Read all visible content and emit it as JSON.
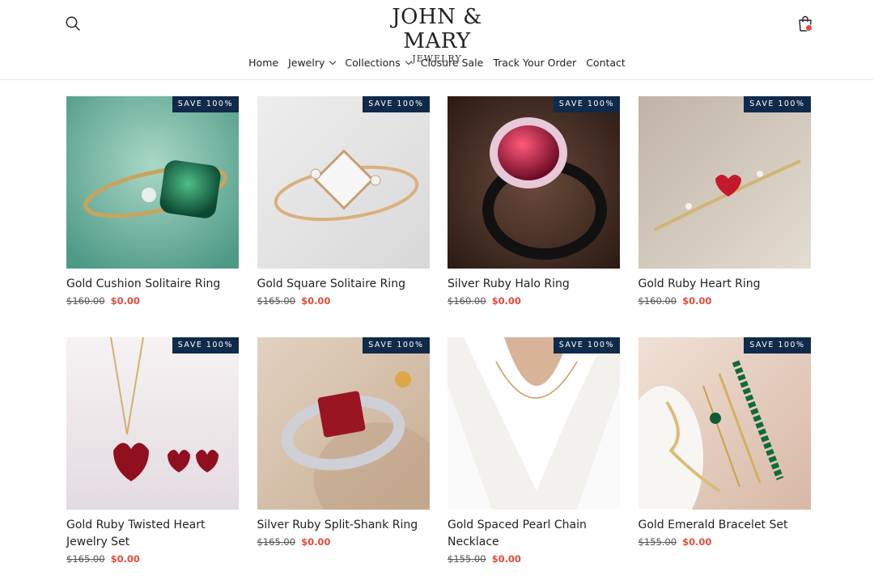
{
  "brand": {
    "name": "JOHN & MARY",
    "sub": "JEWELRY"
  },
  "nav": {
    "items": [
      {
        "label": "Home",
        "dropdown": false
      },
      {
        "label": "Jewelry",
        "dropdown": true
      },
      {
        "label": "Collections",
        "dropdown": true
      },
      {
        "label": "Closure Sale",
        "dropdown": false
      },
      {
        "label": "Track Your Order",
        "dropdown": false
      },
      {
        "label": "Contact",
        "dropdown": false
      }
    ]
  },
  "icons": {
    "search": "search-icon",
    "cart": "shopping-bag-icon"
  },
  "colors": {
    "badge": "#0f2a4a",
    "sale_price": "#e24b3b",
    "cart_dot": "#e8473a"
  },
  "products": [
    {
      "badge": "SAVE 100%",
      "title": "Gold Cushion Solitaire Ring",
      "old_price": "$160.00",
      "price": "$0.00"
    },
    {
      "badge": "SAVE 100%",
      "title": "Gold Square Solitaire Ring",
      "old_price": "$165.00",
      "price": "$0.00"
    },
    {
      "badge": "SAVE 100%",
      "title": "Silver Ruby Halo Ring",
      "old_price": "$160.00",
      "price": "$0.00"
    },
    {
      "badge": "SAVE 100%",
      "title": "Gold Ruby Heart Ring",
      "old_price": "$160.00",
      "price": "$0.00"
    },
    {
      "badge": "SAVE 100%",
      "title": "Gold Ruby Twisted Heart Jewelry Set",
      "old_price": "$165.00",
      "price": "$0.00"
    },
    {
      "badge": "SAVE 100%",
      "title": "Silver Ruby Split-Shank Ring",
      "old_price": "$165.00",
      "price": "$0.00"
    },
    {
      "badge": "SAVE 100%",
      "title": "Gold Spaced Pearl Chain Necklace",
      "old_price": "$155.00",
      "price": "$0.00"
    },
    {
      "badge": "SAVE 100%",
      "title": "Gold Emerald Bracelet Set",
      "old_price": "$155.00",
      "price": "$0.00"
    }
  ]
}
